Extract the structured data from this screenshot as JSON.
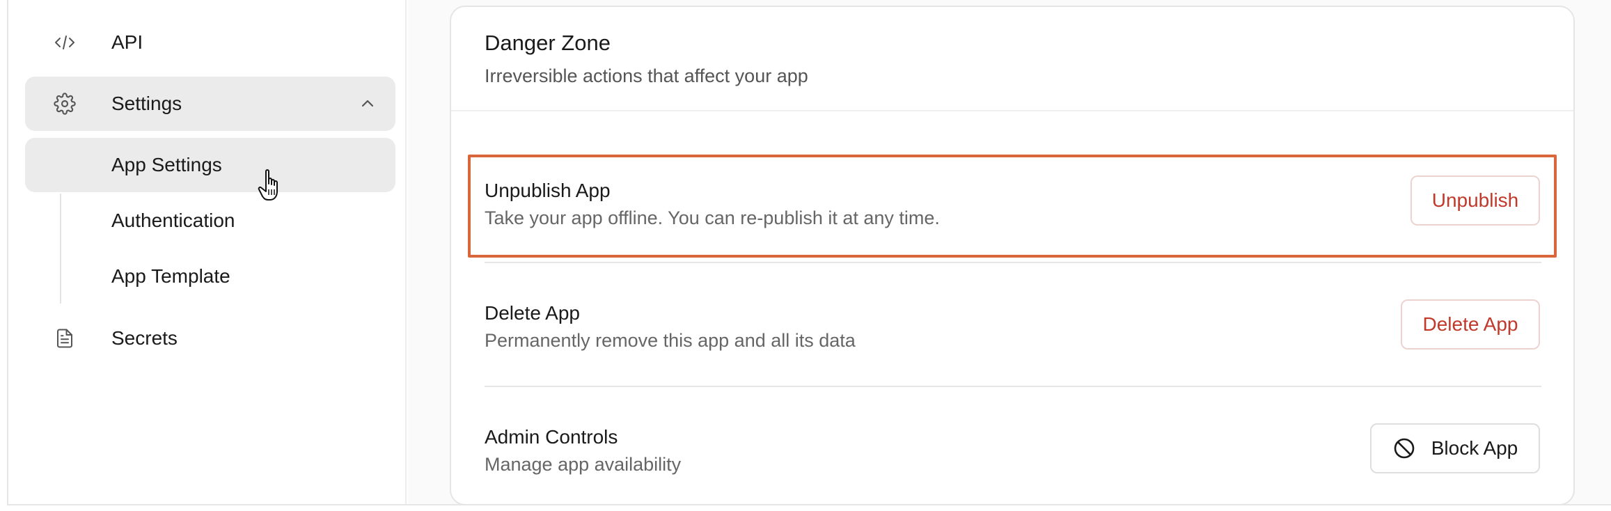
{
  "sidebar": {
    "items": [
      {
        "label": "API",
        "icon": "code-icon"
      },
      {
        "label": "Settings",
        "icon": "gear-icon",
        "expanded": true
      },
      {
        "label": "Secrets",
        "icon": "document-icon"
      }
    ],
    "settings_subitems": [
      {
        "label": "App Settings",
        "active": true
      },
      {
        "label": "Authentication"
      },
      {
        "label": "App Template"
      }
    ]
  },
  "danger_zone": {
    "title": "Danger Zone",
    "subtitle": "Irreversible actions that affect your app",
    "rows": [
      {
        "title": "Unpublish App",
        "description": "Take your app offline. You can re-publish it at any time.",
        "button": "Unpublish"
      },
      {
        "title": "Delete App",
        "description": "Permanently remove this app and all its data",
        "button": "Delete App"
      },
      {
        "title": "Admin Controls",
        "description": "Manage app availability",
        "button": "Block App",
        "button_icon": "block-icon"
      }
    ]
  },
  "colors": {
    "danger_text": "#c0392b",
    "highlight_border": "#d9653b",
    "active_nav_bg": "#ebebeb"
  }
}
